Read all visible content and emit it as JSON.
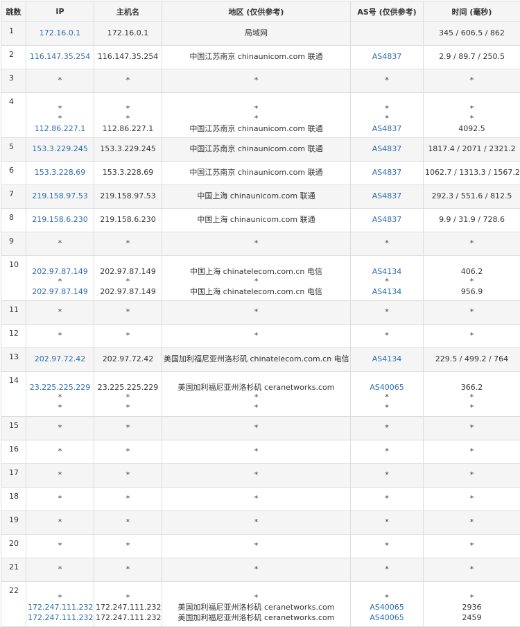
{
  "headers": {
    "hop": "跳数",
    "ip": "IP",
    "host": "主机名",
    "region": "地区 (仅供参考)",
    "as": "AS号 (仅供参考)",
    "time": "时间 (毫秒)"
  },
  "rows": [
    {
      "hop": "1",
      "ip": [
        "172.16.0.1"
      ],
      "host": [
        "172.16.0.1"
      ],
      "region": [
        "局域网"
      ],
      "as": [
        ""
      ],
      "time": [
        "345 / 606.5 / 862"
      ]
    },
    {
      "hop": "2",
      "ip": [
        "116.147.35.254"
      ],
      "host": [
        "116.147.35.254"
      ],
      "region": [
        "中国江苏南京 chinaunicom.com 联通"
      ],
      "as": [
        "AS4837"
      ],
      "time": [
        "2.9 / 89.7 / 250.5"
      ]
    },
    {
      "hop": "3",
      "ip": [
        "*"
      ],
      "host": [
        "*"
      ],
      "region": [
        "*"
      ],
      "as": [
        "*"
      ],
      "time": [
        "*"
      ]
    },
    {
      "hop": "4",
      "ip": [
        "*",
        "*",
        "112.86.227.1"
      ],
      "host": [
        "*",
        "*",
        "112.86.227.1"
      ],
      "region": [
        "*",
        "*",
        "中国江苏南京 chinaunicom.com 联通"
      ],
      "as": [
        "*",
        "*",
        "AS4837"
      ],
      "time": [
        "*",
        "*",
        "4092.5"
      ]
    },
    {
      "hop": "5",
      "ip": [
        "153.3.229.245"
      ],
      "host": [
        "153.3.229.245"
      ],
      "region": [
        "中国江苏南京 chinaunicom.com 联通"
      ],
      "as": [
        "AS4837"
      ],
      "time": [
        "1817.4 / 2071 / 2321.2"
      ]
    },
    {
      "hop": "6",
      "ip": [
        "153.3.228.69"
      ],
      "host": [
        "153.3.228.69"
      ],
      "region": [
        "中国江苏南京 chinaunicom.com 联通"
      ],
      "as": [
        "AS4837"
      ],
      "time": [
        "1062.7 / 1313.3 / 1567.2"
      ]
    },
    {
      "hop": "7",
      "ip": [
        "219.158.97.53"
      ],
      "host": [
        "219.158.97.53"
      ],
      "region": [
        "中国上海 chinaunicom.com 联通"
      ],
      "as": [
        "AS4837"
      ],
      "time": [
        "292.3 / 551.6 / 812.5"
      ]
    },
    {
      "hop": "8",
      "ip": [
        "219.158.6.230"
      ],
      "host": [
        "219.158.6.230"
      ],
      "region": [
        "中国上海 chinaunicom.com 联通"
      ],
      "as": [
        "AS4837"
      ],
      "time": [
        "9.9 / 31.9 / 728.6"
      ]
    },
    {
      "hop": "9",
      "ip": [
        "*"
      ],
      "host": [
        "*"
      ],
      "region": [
        "*"
      ],
      "as": [
        "*"
      ],
      "time": [
        "*"
      ]
    },
    {
      "hop": "10",
      "ip": [
        "202.97.87.149",
        "*",
        "202.97.87.149"
      ],
      "host": [
        "202.97.87.149",
        "*",
        "202.97.87.149"
      ],
      "region": [
        "中国上海 chinatelecom.com.cn 电信",
        "*",
        "中国上海 chinatelecom.com.cn 电信"
      ],
      "as": [
        "AS4134",
        "*",
        "AS4134"
      ],
      "time": [
        "406.2",
        "*",
        "956.9"
      ]
    },
    {
      "hop": "11",
      "ip": [
        "*"
      ],
      "host": [
        "*"
      ],
      "region": [
        "*"
      ],
      "as": [
        "*"
      ],
      "time": [
        "*"
      ]
    },
    {
      "hop": "12",
      "ip": [
        "*"
      ],
      "host": [
        "*"
      ],
      "region": [
        "*"
      ],
      "as": [
        "*"
      ],
      "time": [
        "*"
      ]
    },
    {
      "hop": "13",
      "ip": [
        "202.97.72.42"
      ],
      "host": [
        "202.97.72.42"
      ],
      "region": [
        "美国加利福尼亚州洛杉矶 chinatelecom.com.cn 电信"
      ],
      "as": [
        "AS4134"
      ],
      "time": [
        "229.5 / 499.2 / 764"
      ]
    },
    {
      "hop": "14",
      "ip": [
        "23.225.225.229",
        "*",
        "*"
      ],
      "host": [
        "23.225.225.229",
        "*",
        "*"
      ],
      "region": [
        "美国加利福尼亚州洛杉矶 ceranetworks.com",
        "*",
        "*"
      ],
      "as": [
        "AS40065",
        "*",
        "*"
      ],
      "time": [
        "366.2",
        "*",
        "*"
      ]
    },
    {
      "hop": "15",
      "ip": [
        "*"
      ],
      "host": [
        "*"
      ],
      "region": [
        "*"
      ],
      "as": [
        "*"
      ],
      "time": [
        "*"
      ]
    },
    {
      "hop": "16",
      "ip": [
        "*"
      ],
      "host": [
        "*"
      ],
      "region": [
        "*"
      ],
      "as": [
        "*"
      ],
      "time": [
        "*"
      ]
    },
    {
      "hop": "17",
      "ip": [
        "*"
      ],
      "host": [
        "*"
      ],
      "region": [
        "*"
      ],
      "as": [
        "*"
      ],
      "time": [
        "*"
      ]
    },
    {
      "hop": "18",
      "ip": [
        "*"
      ],
      "host": [
        "*"
      ],
      "region": [
        "*"
      ],
      "as": [
        "*"
      ],
      "time": [
        "*"
      ]
    },
    {
      "hop": "19",
      "ip": [
        "*"
      ],
      "host": [
        "*"
      ],
      "region": [
        "*"
      ],
      "as": [
        "*"
      ],
      "time": [
        "*"
      ]
    },
    {
      "hop": "20",
      "ip": [
        "*"
      ],
      "host": [
        "*"
      ],
      "region": [
        "*"
      ],
      "as": [
        "*"
      ],
      "time": [
        "*"
      ]
    },
    {
      "hop": "21",
      "ip": [
        "*"
      ],
      "host": [
        "*"
      ],
      "region": [
        "*"
      ],
      "as": [
        "*"
      ],
      "time": [
        "*"
      ]
    },
    {
      "hop": "22",
      "ip": [
        "*",
        "172.247.111.232",
        "172.247.111.232"
      ],
      "host": [
        "*",
        "172.247.111.232",
        "172.247.111.232"
      ],
      "region": [
        "*",
        "美国加利福尼亚州洛杉矶 ceranetworks.com",
        "美国加利福尼亚州洛杉矶 ceranetworks.com"
      ],
      "as": [
        "*",
        "AS40065",
        "AS40065"
      ],
      "time": [
        "*",
        "2936",
        "2459"
      ]
    }
  ],
  "colors": {
    "link": "#2b6cb0",
    "header_bg": "#f5f5f5",
    "alt_row_bg": "#f5f5f5",
    "border": "#dddddd"
  }
}
